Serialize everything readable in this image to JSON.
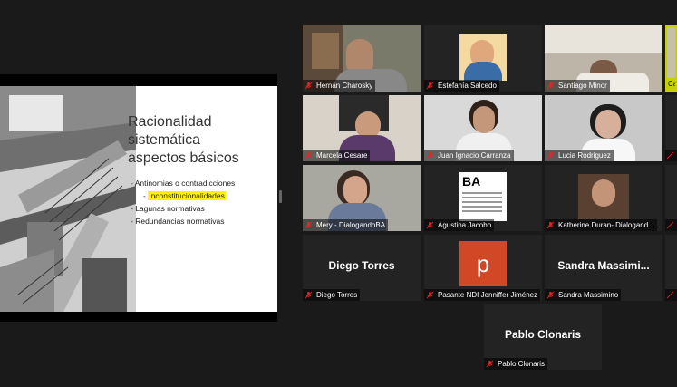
{
  "slide": {
    "title": "Racionalidad\nsistemática\naspectos básicos",
    "bullets": [
      "Antinomias o contradicciones",
      "Inconstitucionalidades",
      "Lagunas normativas",
      "Redundancias normativas"
    ]
  },
  "participants": [
    {
      "name": "Hernán Charosky"
    },
    {
      "name": "Estefanía Salcedo"
    },
    {
      "name": "Santiago Minor"
    },
    {
      "name": "Ca"
    },
    {
      "name": "Marcela Cesare"
    },
    {
      "name": "Juan Ignacio Carranza"
    },
    {
      "name": "Lucia Rodriguez"
    },
    {
      "name": "Mery - DialogandoBA"
    },
    {
      "name": "Agustina Jacobo"
    },
    {
      "name": "Katherine Duran- Dialogand..."
    },
    {
      "name": "Diego Torres",
      "display": "Diego Torres"
    },
    {
      "name": "Pasante NDI Jenniffer Jiménez",
      "display": "p"
    },
    {
      "name": "Sandra Massimino",
      "display": "Sandra  Massimi..."
    },
    {
      "name": "Pablo Clonaris",
      "display": "Pablo Clonaris"
    }
  ],
  "colors": {
    "mic_muted": "#e02828",
    "background": "#1a1a1a",
    "active_speaker": "#c8d000",
    "ppt": "#d24726"
  }
}
